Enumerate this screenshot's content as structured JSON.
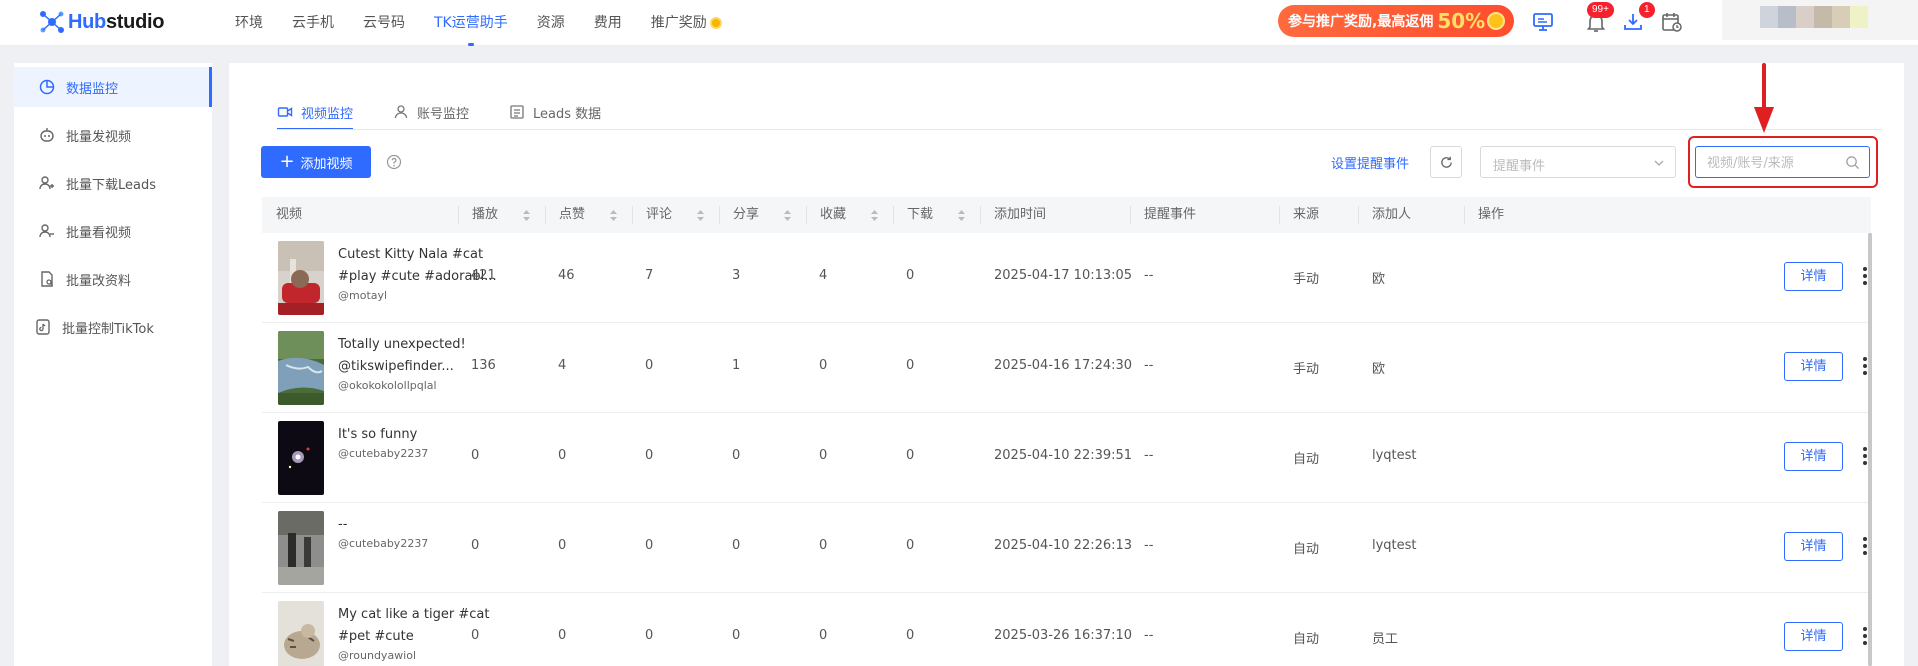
{
  "brand": {
    "name_part1": "Hub",
    "name_part2": "studio",
    "color": "#2f6bff"
  },
  "nav": [
    "环境",
    "云手机",
    "云号码",
    "TK运营助手",
    "资源",
    "费用",
    "推广奖励"
  ],
  "nav_active": "TK运营助手",
  "promo": {
    "text": "参与推广奖励,最高返佣",
    "percent": "50%"
  },
  "badges": {
    "notifications": "99+",
    "downloads": "1"
  },
  "sidebar": {
    "items": [
      {
        "label": "数据监控",
        "icon": "chart-icon",
        "active": true
      },
      {
        "label": "批量发视频",
        "icon": "robot-icon"
      },
      {
        "label": "批量下载Leads",
        "icon": "users-icon"
      },
      {
        "label": "批量看视频",
        "icon": "users-icon"
      },
      {
        "label": "批量改资料",
        "icon": "edit-doc-icon"
      },
      {
        "label": "批量控制TikTok",
        "icon": "tiktok-icon"
      }
    ]
  },
  "tabs": [
    {
      "label": "视频监控",
      "icon": "video-icon",
      "active": true
    },
    {
      "label": "账号监控",
      "icon": "user-icon"
    },
    {
      "label": "Leads 数据",
      "icon": "list-icon"
    }
  ],
  "toolbar": {
    "add_label": "添加视频",
    "remind_link": "设置提醒事件",
    "select_placeholder": "提醒事件",
    "search_placeholder": "视频/账号/来源"
  },
  "table": {
    "headers": [
      "视频",
      "播放",
      "点赞",
      "评论",
      "分享",
      "收藏",
      "下载",
      "添加时间",
      "提醒事件",
      "来源",
      "添加人",
      "操作"
    ],
    "detail_label": "详情",
    "rows": [
      {
        "title": "Cutest Kitty Nala #cat #play #cute #adorabl...",
        "user": "@motayl",
        "play": "421",
        "like": "46",
        "comment": "7",
        "share": "3",
        "fav": "4",
        "download": "0",
        "time": "2025-04-17 10:13:05",
        "remind": "--",
        "source": "手动",
        "adder": "欧",
        "thumb": "cat-red"
      },
      {
        "title": "Totally unexpected! @tikswipefinder...",
        "user": "@okokokolollpqlal",
        "play": "136",
        "like": "4",
        "comment": "0",
        "share": "1",
        "fav": "0",
        "download": "0",
        "time": "2025-04-16 17:24:30",
        "remind": "--",
        "source": "手动",
        "adder": "欧",
        "thumb": "water"
      },
      {
        "title": "It's so funny",
        "user": "@cutebaby2237",
        "play": "0",
        "like": "0",
        "comment": "0",
        "share": "0",
        "fav": "0",
        "download": "0",
        "time": "2025-04-10 22:39:51",
        "remind": "--",
        "source": "自动",
        "adder": "lyqtest",
        "thumb": "night"
      },
      {
        "title": "--",
        "user": "@cutebaby2237",
        "play": "0",
        "like": "0",
        "comment": "0",
        "share": "0",
        "fav": "0",
        "download": "0",
        "time": "2025-04-10 22:26:13",
        "remind": "--",
        "source": "自动",
        "adder": "lyqtest",
        "thumb": "street"
      },
      {
        "title": "My cat like a tiger #cat #pet #cute",
        "user": "@roundyawiol",
        "play": "0",
        "like": "0",
        "comment": "0",
        "share": "0",
        "fav": "0",
        "download": "0",
        "time": "2025-03-26 16:37:10",
        "remind": "--",
        "source": "自动",
        "adder": "员工",
        "thumb": "tabby"
      }
    ]
  }
}
